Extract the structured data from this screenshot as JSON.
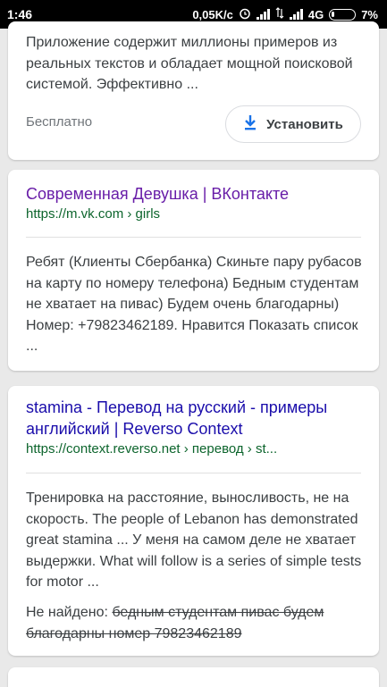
{
  "status_bar": {
    "time": "1:46",
    "network_speed": "0,05K/c",
    "network_type": "4G",
    "battery": "7%",
    "icons": [
      "alarm-icon",
      "signal-icon",
      "signal-icon",
      "battery-icon"
    ]
  },
  "result1": {
    "snippet": "Приложение содержит миллионы примеров из реальных текстов и обладает мощной поисковой системой. Эффективно ...",
    "price": "Бесплатно",
    "install_label": "Установить",
    "install_icon": "download-icon"
  },
  "result2": {
    "title": "Современная Девушка | ВКонтакте",
    "title_color": "#681da8",
    "url": "https://m.vk.com › girls",
    "snippet": "Ребят (Клиенты Сбербанка) Скиньте пару рубасов на карту по номеру телефона) Бедным студентам не хватает на пивас) Будем очень благодарны) Номер: +79823462189. Нравится Показать список ..."
  },
  "result3": {
    "title": "stamina - Перевод на русский - примеры английский | Reverso Context",
    "title_color": "#1a0dab",
    "url": "https://context.reverso.net › перевод › st...",
    "snippet": "Тренировка на расстояние, выносливость, не на скорость. The people of Lebanon has demonstrated great stamina ... У меня на самом деле не хватает выдержки. What will follow is a series of simple tests for motor ...",
    "missing_label": "Не найдено:",
    "missing_terms": "бедным студентам пивас будем благодарны номер 79823462189"
  },
  "colors": {
    "url_green": "#0d652d",
    "download_blue": "#1a73e8"
  }
}
